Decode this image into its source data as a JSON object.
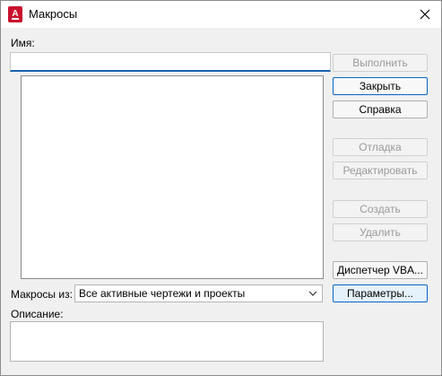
{
  "window": {
    "title": "Макросы"
  },
  "name_field": {
    "label": "Имя:",
    "value": ""
  },
  "buttons": {
    "run": "Выполнить",
    "close": "Закрыть",
    "help": "Справка",
    "debug": "Отладка",
    "edit": "Редактировать",
    "create": "Создать",
    "delete": "Удалить",
    "vba_manager": "Диспетчер VBA...",
    "options": "Параметры..."
  },
  "macros_in": {
    "label": "Макросы из:",
    "selected": "Все активные чертежи и проекты"
  },
  "description": {
    "label": "Описание:",
    "value": ""
  },
  "colors": {
    "accent": "#0a64c8",
    "app_icon": "#c8102e"
  }
}
